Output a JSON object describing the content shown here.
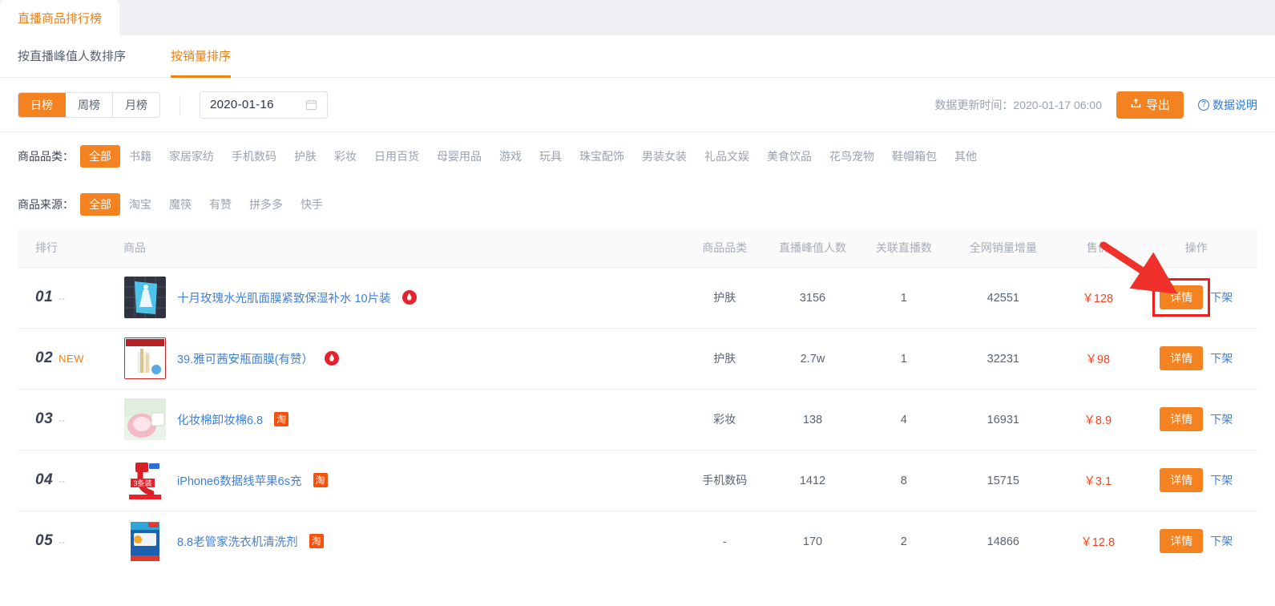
{
  "app_tab": {
    "label": "直播商品排行榜"
  },
  "sort_tabs": [
    {
      "label": "按直播峰值人数排序",
      "active": false
    },
    {
      "label": "按销量排序",
      "active": true
    }
  ],
  "period": {
    "options": [
      {
        "label": "日榜",
        "active": true
      },
      {
        "label": "周榜",
        "active": false
      },
      {
        "label": "月榜",
        "active": false
      }
    ]
  },
  "date_picker": {
    "value": "2020-01-16",
    "icon": "calendar-icon"
  },
  "toolbar": {
    "update_time": "数据更新时间：2020-01-17 06:00",
    "export_label": "导出",
    "export_icon": "upload-icon",
    "help_label": "数据说明",
    "help_icon": "question-circle-icon"
  },
  "facets": [
    {
      "label": "商品品类：",
      "options": [
        "全部",
        "书籍",
        "家居家纺",
        "手机数码",
        "护肤",
        "彩妆",
        "日用百货",
        "母婴用品",
        "游戏",
        "玩具",
        "珠宝配饰",
        "男装女装",
        "礼品文娱",
        "美食饮品",
        "花鸟宠物",
        "鞋帽箱包",
        "其他"
      ],
      "active": "全部"
    },
    {
      "label": "商品来源：",
      "options": [
        "全部",
        "淘宝",
        "魔筷",
        "有赞",
        "拼多多",
        "快手"
      ],
      "active": "全部"
    }
  ],
  "table": {
    "headers": {
      "rank": "排行",
      "product": "商品",
      "category": "商品品类",
      "peak": "直播峰值人数",
      "lives": "关联直播数",
      "sales": "全网销量增量",
      "price": "售价",
      "action": "操作"
    },
    "rows": [
      {
        "rank": "01",
        "delta": "--",
        "delta_is_new": false,
        "title": "十月玫瑰水光肌面膜紧致保湿补水 10片装",
        "badge": "kuaishou",
        "thumb": "mask-blue-pack",
        "category": "护肤",
        "peak": "3156",
        "lives": "1",
        "sales": "42551",
        "price": "￥128",
        "detail_label": "详情",
        "offshelf_label": "下架"
      },
      {
        "rank": "02",
        "delta": "NEW",
        "delta_is_new": true,
        "title": "39.雅可茜安瓶面膜(有赞）",
        "badge": "kuaishou",
        "thumb": "ampoule-box-red",
        "category": "护肤",
        "peak": "2.7w",
        "lives": "1",
        "sales": "32231",
        "price": "￥98",
        "detail_label": "详情",
        "offshelf_label": "下架"
      },
      {
        "rank": "03",
        "delta": "--",
        "delta_is_new": false,
        "title": "化妆棉卸妆棉6.8",
        "badge": "taobao",
        "thumb": "cotton-pads-pink",
        "category": "彩妆",
        "peak": "138",
        "lives": "4",
        "sales": "16931",
        "price": "￥8.9",
        "detail_label": "详情",
        "offshelf_label": "下架"
      },
      {
        "rank": "04",
        "delta": "--",
        "delta_is_new": false,
        "title": "iPhone6数据线苹果6s充",
        "badge": "taobao",
        "thumb": "red-cable",
        "category": "手机数码",
        "peak": "1412",
        "lives": "8",
        "sales": "15715",
        "price": "￥3.1",
        "detail_label": "详情",
        "offshelf_label": "下架"
      },
      {
        "rank": "05",
        "delta": "--",
        "delta_is_new": false,
        "title": "8.8老管家洗衣机清洗剂",
        "badge": "taobao",
        "thumb": "detergent-box",
        "category": "-",
        "peak": "170",
        "lives": "2",
        "sales": "14866",
        "price": "￥12.8",
        "detail_label": "详情",
        "offshelf_label": "下架"
      }
    ]
  },
  "annotation": {
    "highlight_target": "detail-button-row-1",
    "box_color": "#f11d1d",
    "arrow_color": "#f0302a"
  },
  "colors": {
    "accent": "#f58220",
    "link": "#3f7fd6",
    "price": "#f4441f",
    "page_bg": "#eef0f4"
  }
}
